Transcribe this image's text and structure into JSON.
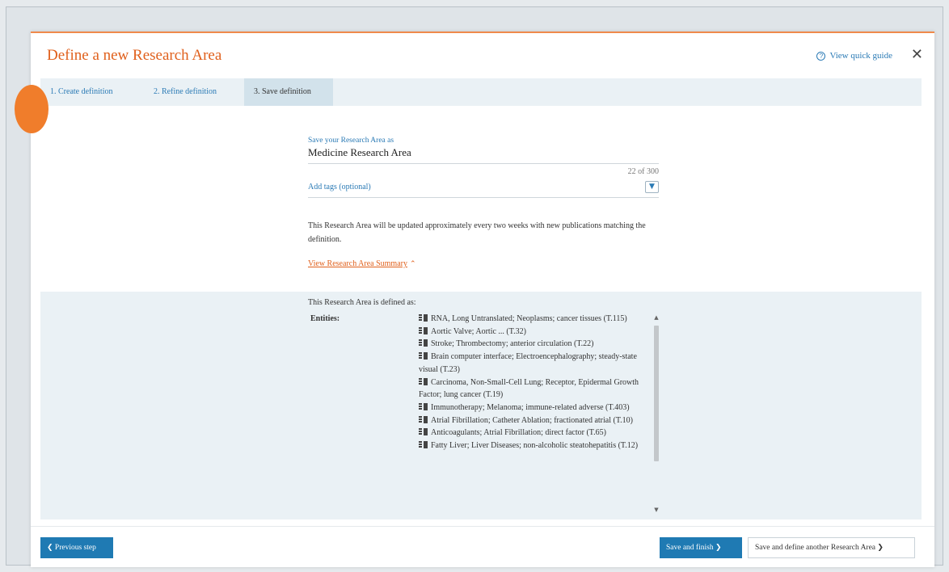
{
  "dialog": {
    "title": "Define a new Research Area",
    "quick_guide_label": "View quick guide",
    "quick_guide_icon": "?",
    "close_label": "✕"
  },
  "tabs": [
    {
      "label": "1. Create definition",
      "active": false
    },
    {
      "label": "2. Refine definition",
      "active": false
    },
    {
      "label": "3. Save definition",
      "active": true
    }
  ],
  "form": {
    "name_label": "Save your Research Area as",
    "name_value": "Medicine Research Area",
    "char_count": "22 of 300",
    "tags_label": "Add tags (optional)",
    "description": "This Research Area will be updated approximately every two weeks with new publications matching the definition.",
    "summary_link": "View Research Area Summary"
  },
  "summary": {
    "heading": "This Research Area is defined as:",
    "entities_label": "Entities:",
    "entities": [
      "RNA, Long Untranslated; Neoplasms; cancer tissues (T.115)",
      "Aortic Valve; Aortic ... (T.32)",
      "Stroke; Thrombectomy; anterior circulation (T.22)",
      "Brain computer interface; Electroencephalography; steady-state visual (T.23)",
      "Carcinoma, Non-Small-Cell Lung; Receptor, Epidermal Growth Factor; lung cancer (T.19)",
      "Immunotherapy; Melanoma; immune-related adverse (T.403)",
      "Atrial Fibrillation; Catheter Ablation; fractionated atrial (T.10)",
      "Anticoagulants; Atrial Fibrillation; direct factor (T.65)",
      "Fatty Liver; Liver Diseases; non-alcoholic steatohepatitis (T.12)"
    ]
  },
  "footer": {
    "prev_label": "Previous step",
    "finish_label": "Save and finish",
    "another_label": "Save and define another Research Area"
  },
  "colors": {
    "accent_orange": "#e0601c",
    "link_blue": "#2a7ab5",
    "button_blue": "#1f7ab3",
    "panel_bg": "#eaf1f5"
  }
}
